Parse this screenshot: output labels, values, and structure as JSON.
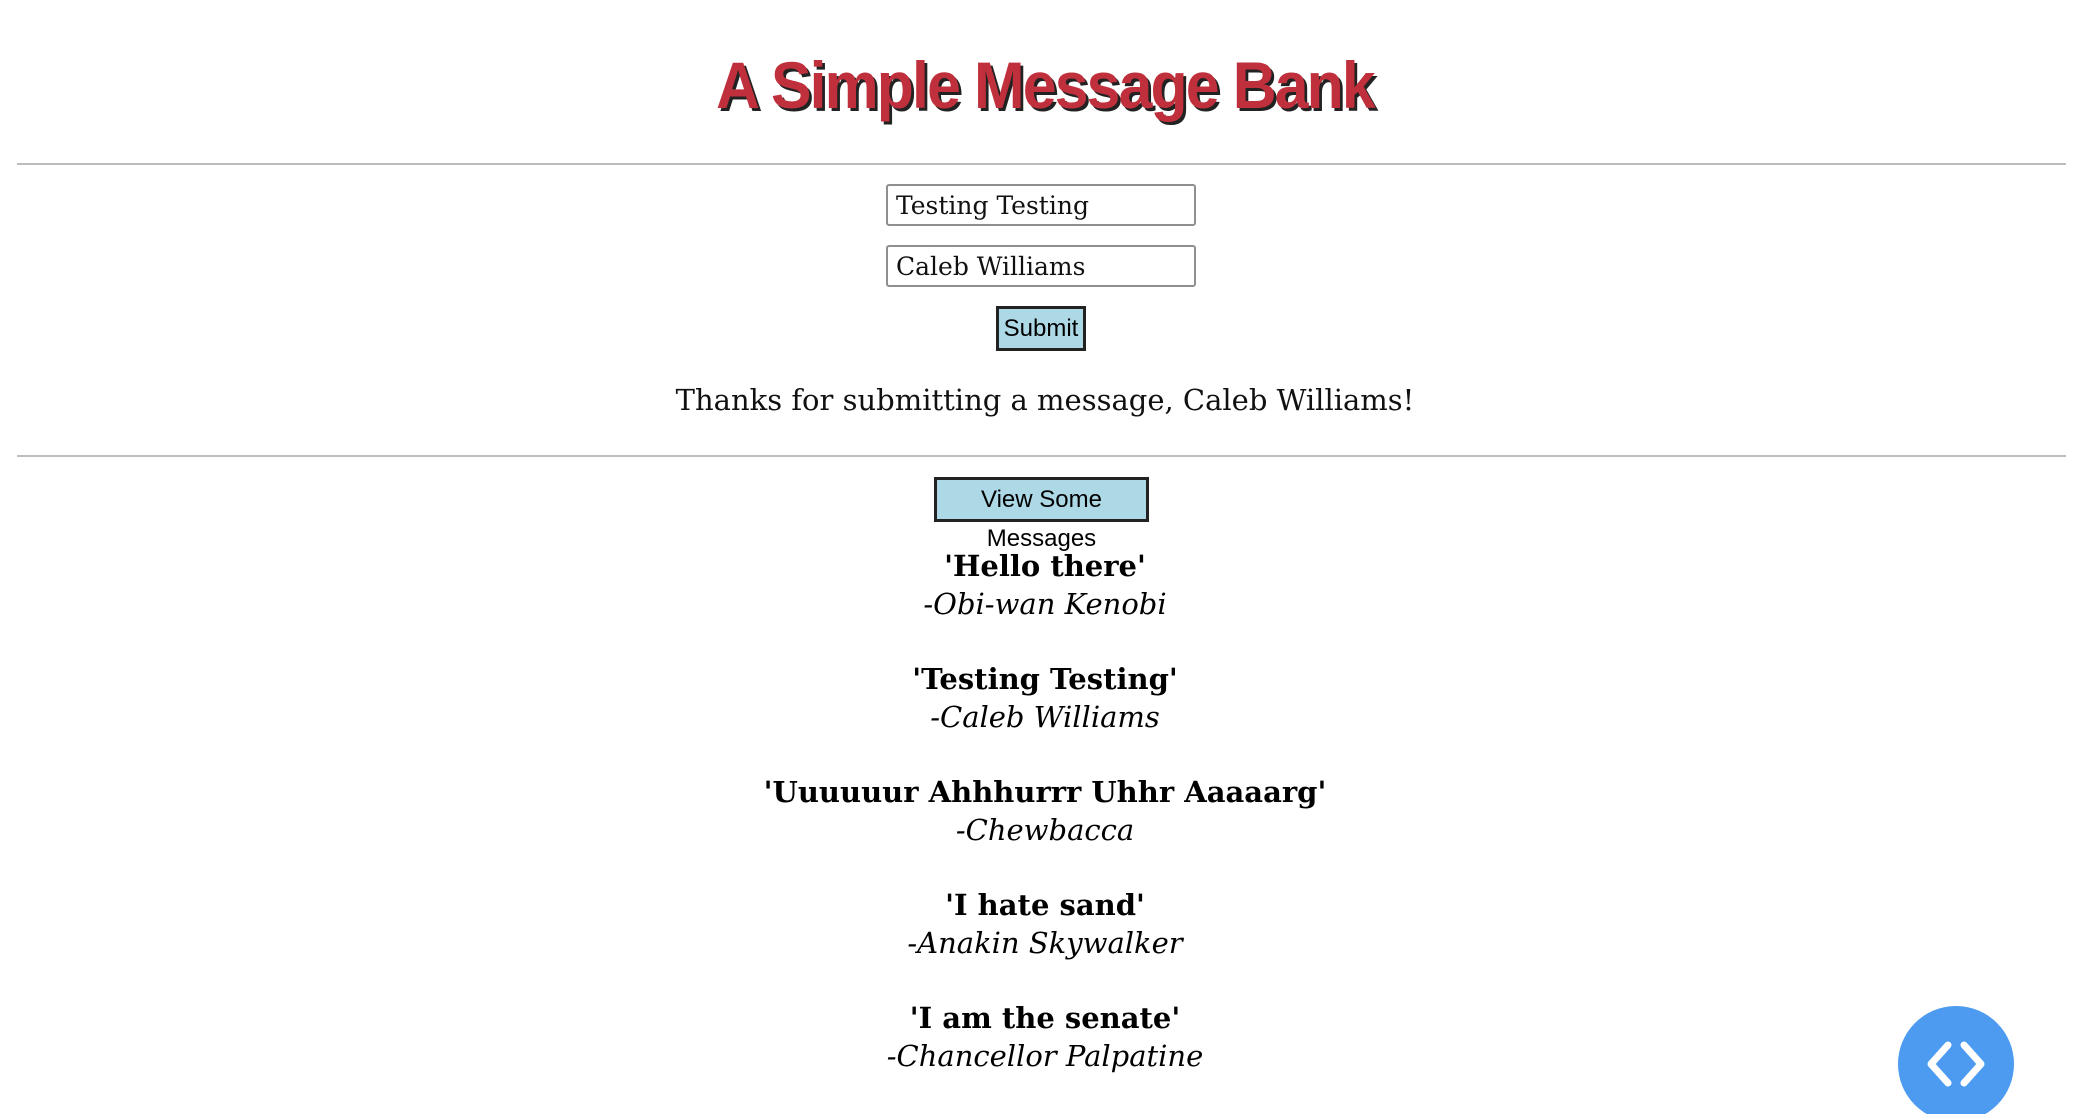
{
  "header": {
    "title": "A Simple Message Bank"
  },
  "form": {
    "message_value": "Testing Testing",
    "name_value": "Caleb Williams",
    "submit_label": "Submit",
    "confirmation": "Thanks for submitting a message, Caleb Williams!"
  },
  "messages_section": {
    "view_button_label": "View Some Messages",
    "items": [
      {
        "text": "'Hello there'",
        "author": "-Obi-wan Kenobi"
      },
      {
        "text": "'Testing Testing'",
        "author": "-Caleb Williams"
      },
      {
        "text": "'Uuuuuur Ahhhurrr Uhhr Aaaaarg'",
        "author": "-Chewbacca"
      },
      {
        "text": "'I hate sand'",
        "author": "-Anakin Skywalker"
      },
      {
        "text": "'I am the senate'",
        "author": "-Chancellor Palpatine"
      }
    ]
  },
  "widgets": {
    "code_toggle_icon": "code-brackets-icon",
    "code_toggle_color": "#4c9bf0"
  },
  "colors": {
    "title": "#c0303c",
    "button_bg": "#add8e6"
  }
}
